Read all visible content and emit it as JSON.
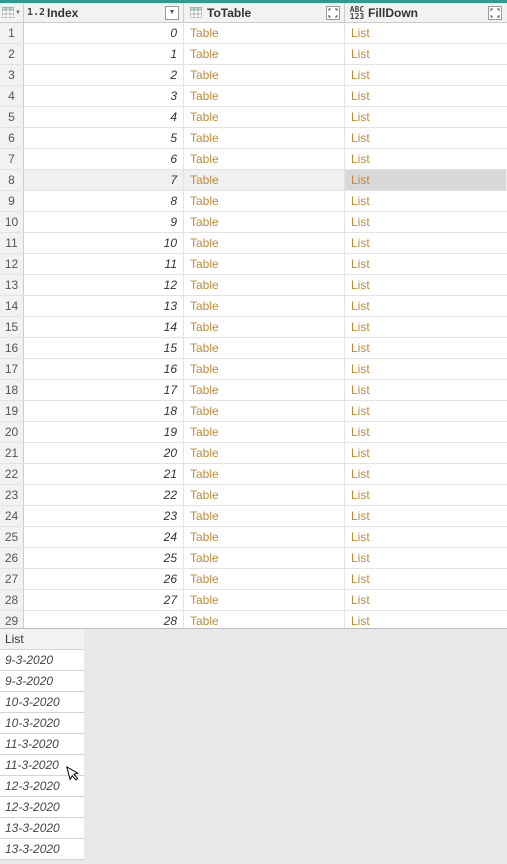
{
  "columns": {
    "col1": {
      "label": "Index",
      "type": "1.2"
    },
    "col2": {
      "label": "ToTable",
      "type_icon": "table"
    },
    "col3": {
      "label": "FillDown",
      "type": "ABC123"
    }
  },
  "selected_row": 8,
  "rows": [
    {
      "n": "1",
      "index": "0",
      "totable": "Table",
      "filldown": "List"
    },
    {
      "n": "2",
      "index": "1",
      "totable": "Table",
      "filldown": "List"
    },
    {
      "n": "3",
      "index": "2",
      "totable": "Table",
      "filldown": "List"
    },
    {
      "n": "4",
      "index": "3",
      "totable": "Table",
      "filldown": "List"
    },
    {
      "n": "5",
      "index": "4",
      "totable": "Table",
      "filldown": "List"
    },
    {
      "n": "6",
      "index": "5",
      "totable": "Table",
      "filldown": "List"
    },
    {
      "n": "7",
      "index": "6",
      "totable": "Table",
      "filldown": "List"
    },
    {
      "n": "8",
      "index": "7",
      "totable": "Table",
      "filldown": "List"
    },
    {
      "n": "9",
      "index": "8",
      "totable": "Table",
      "filldown": "List"
    },
    {
      "n": "10",
      "index": "9",
      "totable": "Table",
      "filldown": "List"
    },
    {
      "n": "11",
      "index": "10",
      "totable": "Table",
      "filldown": "List"
    },
    {
      "n": "12",
      "index": "11",
      "totable": "Table",
      "filldown": "List"
    },
    {
      "n": "13",
      "index": "12",
      "totable": "Table",
      "filldown": "List"
    },
    {
      "n": "14",
      "index": "13",
      "totable": "Table",
      "filldown": "List"
    },
    {
      "n": "15",
      "index": "14",
      "totable": "Table",
      "filldown": "List"
    },
    {
      "n": "16",
      "index": "15",
      "totable": "Table",
      "filldown": "List"
    },
    {
      "n": "17",
      "index": "16",
      "totable": "Table",
      "filldown": "List"
    },
    {
      "n": "18",
      "index": "17",
      "totable": "Table",
      "filldown": "List"
    },
    {
      "n": "19",
      "index": "18",
      "totable": "Table",
      "filldown": "List"
    },
    {
      "n": "20",
      "index": "19",
      "totable": "Table",
      "filldown": "List"
    },
    {
      "n": "21",
      "index": "20",
      "totable": "Table",
      "filldown": "List"
    },
    {
      "n": "22",
      "index": "21",
      "totable": "Table",
      "filldown": "List"
    },
    {
      "n": "23",
      "index": "22",
      "totable": "Table",
      "filldown": "List"
    },
    {
      "n": "24",
      "index": "23",
      "totable": "Table",
      "filldown": "List"
    },
    {
      "n": "25",
      "index": "24",
      "totable": "Table",
      "filldown": "List"
    },
    {
      "n": "26",
      "index": "25",
      "totable": "Table",
      "filldown": "List"
    },
    {
      "n": "27",
      "index": "26",
      "totable": "Table",
      "filldown": "List"
    },
    {
      "n": "28",
      "index": "27",
      "totable": "Table",
      "filldown": "List"
    },
    {
      "n": "29",
      "index": "28",
      "totable": "Table",
      "filldown": "List"
    }
  ],
  "preview": {
    "title": "List",
    "items": [
      "9-3-2020",
      "9-3-2020",
      "10-3-2020",
      "10-3-2020",
      "11-3-2020",
      "11-3-2020",
      "12-3-2020",
      "12-3-2020",
      "13-3-2020",
      "13-3-2020"
    ]
  }
}
